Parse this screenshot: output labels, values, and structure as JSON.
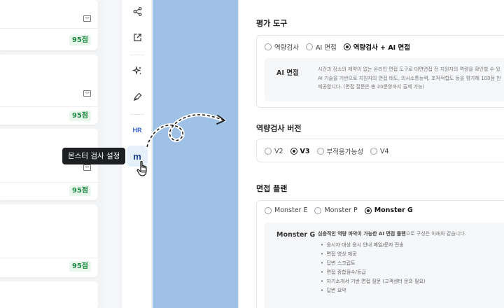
{
  "left_cards": [
    {
      "score": "95점"
    },
    {
      "score": "95점"
    },
    {
      "score": "95점"
    },
    {
      "score": "95점"
    }
  ],
  "toolbar": {
    "icons": [
      "share-icon",
      "external-link-icon",
      "sparkle-icon",
      "pen-icon"
    ],
    "hr_label": "HR",
    "monster_label": "m",
    "tooltip": "몬스터 검사 설정"
  },
  "panel": {
    "assessment_tool": {
      "title": "평가 도구",
      "options": [
        "역량검사",
        "AI 면접",
        "역량검사 + AI 면접"
      ],
      "selected": "역량검사 + AI 면접",
      "desc_title": "AI 면접",
      "desc_lines": [
        "시간과 장소의 제약이 없는 온라인 면접 도구로 대면면접 전 지원자의 역량을 확인할 수 있",
        "AI 기술을 기반으로 지원자의 면접 태도, 의사소통능력, 조직적합도 등을 평가해 100점 만",
        "제공합니다. (면접 질문은 총 20문항까지 출제 가능)"
      ]
    },
    "version": {
      "title": "역량검사 버전",
      "options": [
        "V2",
        "V3",
        "부적응가능성",
        "V4"
      ],
      "selected": "V3"
    },
    "interview_plan": {
      "title": "면접 플랜",
      "options": [
        "Monster E",
        "Monster P",
        "Monster G"
      ],
      "selected": "Monster G",
      "desc_title": "Monster G",
      "desc_intro_bold": "심층적인 역량 파악이 가능한 AI 면접 플랜",
      "desc_intro_rest": "으로 구성은 아래와 같습니다.",
      "bullets": [
        "응시자 대상 응시 안내 메일/문자 전송",
        "면접 영상 제공",
        "답변 스크립트",
        "면접 종합점수/등급",
        "자기소개서 기반 면접 질문 (고객센터 문의 필요)",
        "답변 요약"
      ]
    }
  },
  "colors": {
    "accent_blue": "#9fc1e6",
    "score_green": "#1f8a44",
    "tooltip_bg": "#1d1f23"
  }
}
